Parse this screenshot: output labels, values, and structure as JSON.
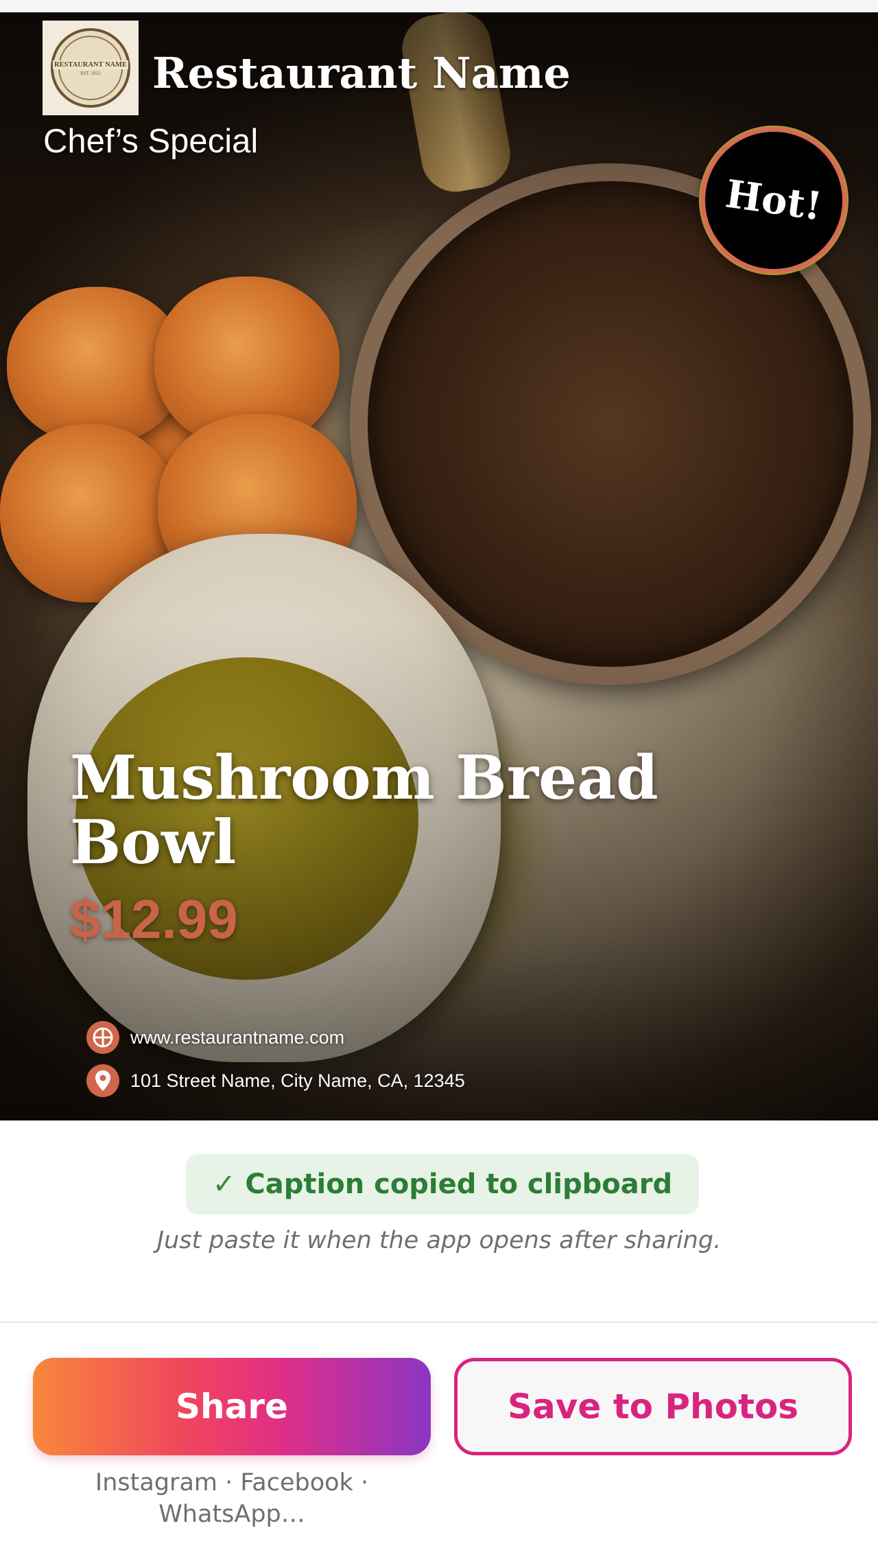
{
  "poster": {
    "restaurant_name": "Restaurant Name",
    "logo_text": "Restaurant Name",
    "logo_subtext": "EST. 2021",
    "tagline": "Chef’s Special",
    "badge": "Hot!",
    "dish_name": "Mushroom Bread Bowl",
    "price": "$12.99",
    "website": "www.restaurantname.com",
    "address": "101 Street Name, City Name, CA, 12345",
    "accent_color": "#d0664b"
  },
  "toast": {
    "icon": "checkmark-icon",
    "message": "Caption copied to clipboard"
  },
  "hint": "Just paste it when the app opens after sharing.",
  "actions": {
    "share_label": "Share",
    "save_label": "Save to Photos",
    "share_platforms": "Instagram · Facebook · WhatsApp…"
  },
  "colors": {
    "share_gradient": [
      "#f7873b",
      "#f0465c",
      "#e12e86",
      "#8a36c4"
    ],
    "save_accent": "#d9247f",
    "toast_bg": "#e7f3e6",
    "toast_text": "#2c7d35"
  }
}
